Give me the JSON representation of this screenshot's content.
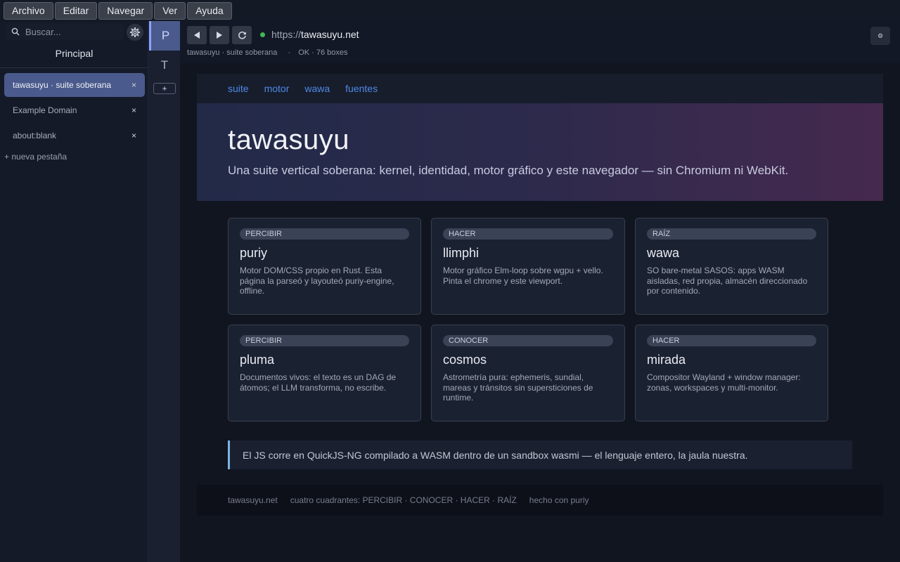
{
  "menubar": {
    "items": [
      "Archivo",
      "Editar",
      "Navegar",
      "Ver",
      "Ayuda"
    ]
  },
  "sidebar": {
    "search_placeholder": "Buscar...",
    "title": "Principal",
    "tabs": [
      {
        "label": "tawasuyu · suite soberana",
        "active": true
      },
      {
        "label": "Example Domain",
        "active": false
      },
      {
        "label": "about:blank",
        "active": false
      }
    ],
    "close_glyph": "×",
    "new_tab_label": "+  nueva pestaña"
  },
  "rail": {
    "buttons": [
      {
        "label": "P",
        "active": true
      },
      {
        "label": "T",
        "active": false
      }
    ],
    "add_label": "+"
  },
  "toolbar": {
    "back_icon": "back-arrow-icon",
    "forward_icon": "forward-arrow-icon",
    "reload_icon": "reload-icon",
    "url_scheme": "https://",
    "url_host": "tawasuyu.net",
    "status_title": "tawasuyu · suite soberana",
    "status_sep": "·",
    "status_info": "OK · 76 boxes",
    "ext_glyph": "⚙"
  },
  "page": {
    "nav": [
      "suite",
      "motor",
      "wawa",
      "fuentes"
    ],
    "hero_title": "tawasuyu",
    "hero_subtitle": "Una suite vertical soberana: kernel, identidad, motor gráfico y este navegador — sin Chromium ni WebKit.",
    "cards": [
      {
        "tag": "PERCIBIR",
        "title": "puriy",
        "desc": "Motor DOM/CSS propio en Rust. Esta página la parseó y layouteó puriy-engine, offline."
      },
      {
        "tag": "HACER",
        "title": "llimphi",
        "desc": "Motor gráfico Elm-loop sobre wgpu + vello. Pinta el chrome y este viewport."
      },
      {
        "tag": "RAÍZ",
        "title": "wawa",
        "desc": "SO bare-metal SASOS: apps WASM aisladas, red propia, almacén direccionado por contenido."
      },
      {
        "tag": "PERCIBIR",
        "title": "pluma",
        "desc": "Documentos vivos: el texto es un DAG de átomos; el LLM transforma, no escribe."
      },
      {
        "tag": "CONOCER",
        "title": "cosmos",
        "desc": "Astrometría pura: ephemeris, sundial, mareas y tránsitos sin supersticiones de runtime."
      },
      {
        "tag": "HACER",
        "title": "mirada",
        "desc": "Compositor Wayland + window manager: zonas, workspaces y multi-monitor."
      }
    ],
    "quote": "El JS corre en QuickJS-NG compilado a WASM dentro de un sandbox wasmi — el lenguaje entero, la jaula nuestra.",
    "footer": [
      "tawasuyu.net",
      "cuatro cuadrantes: PERCIBIR · CONOCER · HACER · RAÍZ",
      "hecho con puriy"
    ]
  },
  "colors": {
    "accent": "#4a5a8c",
    "link": "#4f89e8",
    "secure": "#3fb950"
  }
}
